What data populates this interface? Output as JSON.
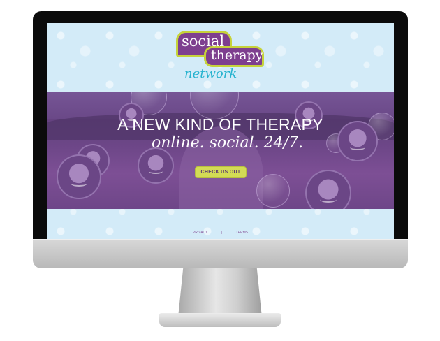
{
  "logo": {
    "word_social": "social",
    "word_therapy": "therapy",
    "word_network": "network"
  },
  "hero": {
    "headline": "A NEW KIND OF THERAPY",
    "subheadline": "online. social. 24/7.",
    "cta_label": "CHECK US OUT"
  },
  "footer": {
    "privacy_label": "PRIVACY",
    "separator": "|",
    "terms_label": "TERMS"
  },
  "colors": {
    "brand_purple": "#7e3f8f",
    "brand_lime": "#c6d23b",
    "brand_teal": "#27b3cf",
    "background_light_blue": "#d3ebf8"
  }
}
